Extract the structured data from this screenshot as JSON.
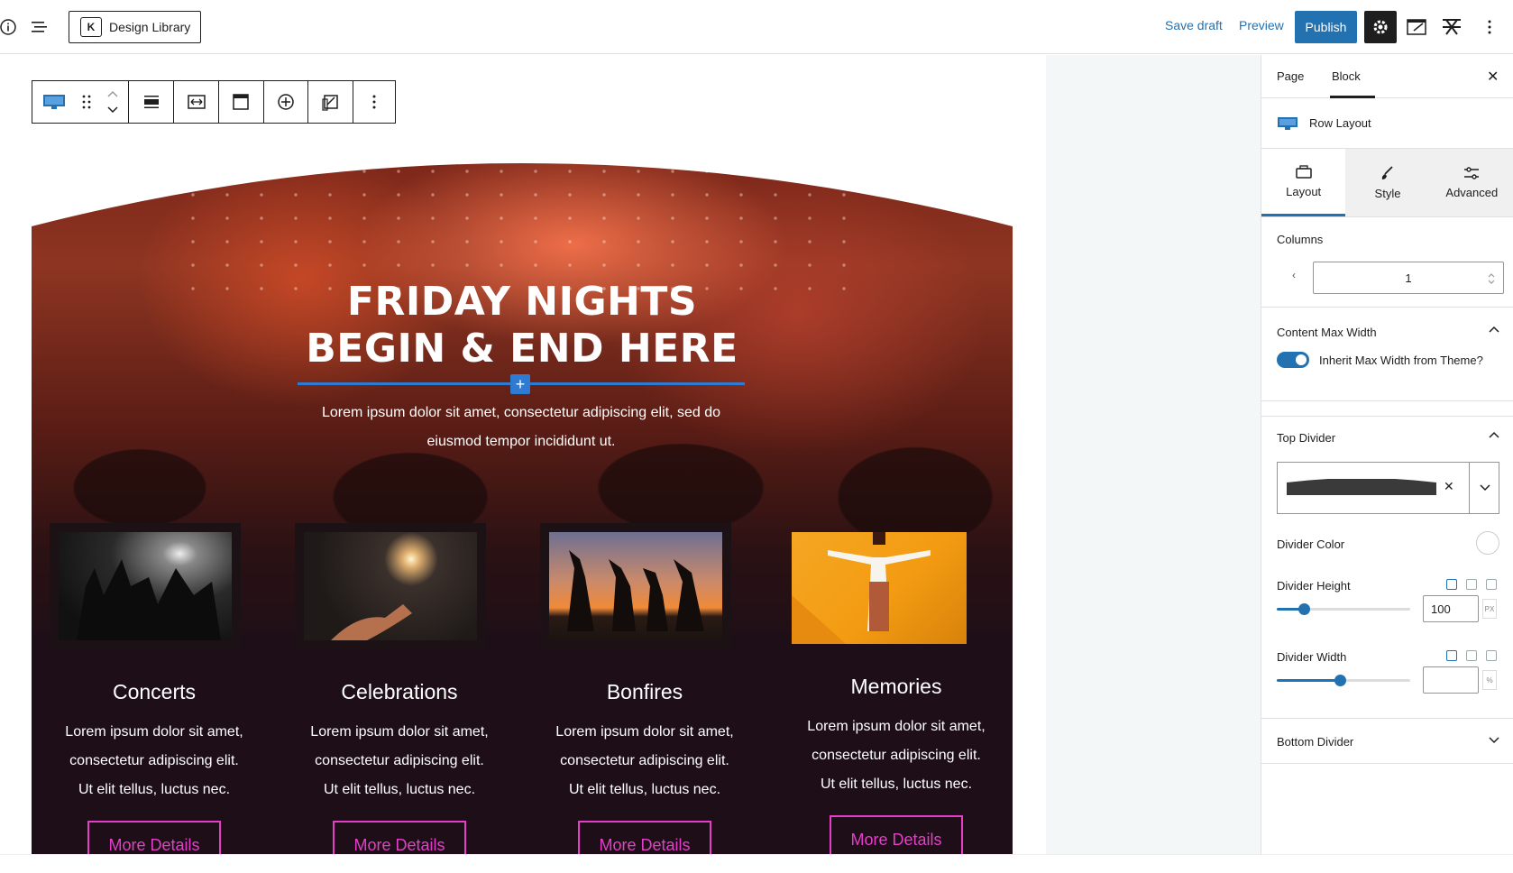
{
  "topbar": {
    "design_library_label": "Design Library",
    "save_draft_label": "Save draft",
    "preview_label": "Preview",
    "publish_label": "Publish"
  },
  "hero": {
    "headline_line1": "FRIDAY NIGHTS",
    "headline_line2": "BEGIN & END HERE",
    "subtext": "Lorem ipsum dolor sit amet, consectetur adipiscing elit, sed do eiusmod tempor incididunt ut."
  },
  "cards": [
    {
      "title": "Concerts",
      "text_line1": "Lorem ipsum dolor sit amet,",
      "text_line2": "consectetur adipiscing elit.",
      "text_line3": "Ut elit tellus, luctus nec.",
      "button": "More Details"
    },
    {
      "title": "Celebrations",
      "text_line1": "Lorem ipsum dolor sit amet,",
      "text_line2": "consectetur adipiscing elit.",
      "text_line3": "Ut elit tellus, luctus nec.",
      "button": "More Details"
    },
    {
      "title": "Bonfires",
      "text_line1": "Lorem ipsum dolor sit amet,",
      "text_line2": "consectetur adipiscing elit.",
      "text_line3": "Ut elit tellus, luctus nec.",
      "button": "More Details"
    },
    {
      "title": "Memories",
      "text_line1": "Lorem ipsum dolor sit amet,",
      "text_line2": "consectetur adipiscing elit.",
      "text_line3": "Ut elit tellus, luctus nec.",
      "button": "More Details"
    }
  ],
  "sidebar": {
    "tab_page": "Page",
    "tab_block": "Block",
    "close_label": "✕",
    "block_name": "Row Layout",
    "subtab_layout": "Layout",
    "subtab_style": "Style",
    "subtab_advanced": "Advanced",
    "columns_label": "Columns",
    "columns_value": "1",
    "content_max_width_label": "Content Max Width",
    "inherit_label": "Inherit Max Width from Theme?",
    "inherit_enabled": true,
    "top_divider_label": "Top Divider",
    "divider_color_label": "Divider Color",
    "divider_height_label": "Divider Height",
    "divider_height_value": "100",
    "divider_height_unit": "PX",
    "divider_height_fraction": 0.2,
    "divider_width_label": "Divider Width",
    "divider_width_value": "",
    "divider_width_unit": "%",
    "divider_width_fraction": 0.47,
    "bottom_divider_label": "Bottom Divider"
  },
  "colors": {
    "accent": "#2271b1",
    "card_button": "#e53ec8",
    "hero_dark": "#1d0e17"
  }
}
